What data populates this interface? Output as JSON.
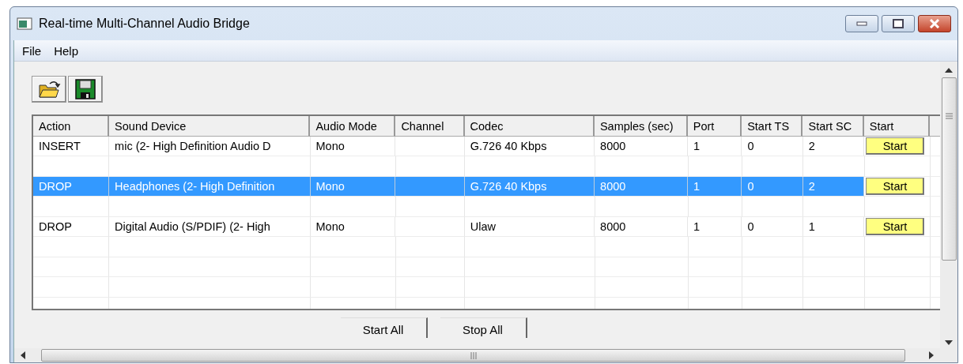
{
  "window": {
    "title": "Real-time Multi-Channel Audio Bridge"
  },
  "menu": [
    "File",
    "Help"
  ],
  "table": {
    "columns": [
      "Action",
      "Sound Device",
      "Audio Mode",
      "Channel",
      "Codec",
      "Samples (sec)",
      "Port",
      "Start TS",
      "Start SC",
      "Start"
    ],
    "rows": [
      {
        "selected": false,
        "cells": [
          "INSERT",
          "mic (2- High Definition Audio D",
          "Mono",
          "",
          "G.726 40 Kbps",
          "8000",
          "1",
          "0",
          "2"
        ],
        "button": "Start"
      },
      {
        "selected": true,
        "cells": [
          "DROP",
          "Headphones (2- High Definition",
          "Mono",
          "",
          "G.726 40 Kbps",
          "8000",
          "1",
          "0",
          "2"
        ],
        "button": "Start"
      },
      {
        "selected": false,
        "cells": [
          "DROP",
          "Digital Audio (S/PDIF) (2- High",
          "Mono",
          "",
          "Ulaw",
          "8000",
          "1",
          "0",
          "1"
        ],
        "button": "Start"
      }
    ]
  },
  "buttons": [
    "Start All",
    "Stop All"
  ]
}
